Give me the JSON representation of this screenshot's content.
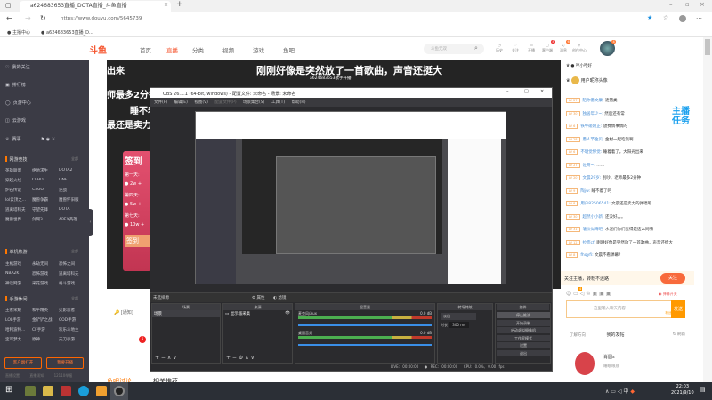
{
  "browser": {
    "tab_title": "a624683653直播_DOTA直播_斗鱼直播",
    "url": "https://www.douyu.com/5645739",
    "bookmarks": [
      "主播中心",
      "a624683653直播_D..."
    ]
  },
  "header": {
    "logo": "斗鱼",
    "nav": [
      "首页",
      "直播",
      "分类",
      "视频",
      "游戏",
      "鱼吧"
    ],
    "search_placeholder": "斗鱼无双",
    "icons": [
      {
        "label": "历史"
      },
      {
        "label": "关注"
      },
      {
        "label": "开播"
      },
      {
        "label": "客户端",
        "badge": "8"
      },
      {
        "label": "消息",
        "badge": "6"
      },
      {
        "label": "创作中心"
      }
    ],
    "avatar_badge": "4"
  },
  "sidebar": {
    "items": [
      "我的关注",
      "排行榜",
      "页游中心",
      "云游戏",
      "赛事"
    ],
    "sections": [
      {
        "title": "网游竞技",
        "more": "全部",
        "games": [
          "英雄联盟",
          "绝地求生",
          "DOTA2",
          "穿越火线",
          "CFHD",
          "DNF",
          "炉石传说",
          "CSGO",
          "逆战",
          "lol云顶之...",
          "魔兽争霸",
          "魔兽怀旧服",
          "逃离塔科夫",
          "守望先锋",
          "DOTA",
          "魔兽世界",
          "剑网3",
          "APEX英雄"
        ]
      },
      {
        "title": "单机热游",
        "more": "全部",
        "games": [
          "主机游戏",
          "永劫无间",
          "恐怖之间",
          "NBA2K",
          "恐怖游戏",
          "逃离塔科夫",
          "神话网游",
          "采花游戏",
          "格斗游戏"
        ]
      },
      {
        "title": "手游休闲",
        "more": "全部",
        "games": [
          "王者荣耀",
          "和平精英",
          "火影忍者",
          "LOL手游",
          "金铲铲之战",
          "COD手游",
          "哈利波特...",
          "CF手游",
          "欢乐斗地主",
          "宝可梦大...",
          "原神",
          "天刀手游"
        ]
      }
    ],
    "buttons": [
      "客户端打开",
      "我要开播"
    ],
    "footer": [
      "直播设置",
      "直播须知",
      "12110举报"
    ]
  },
  "stream": {
    "title": "刚刚好像是突然放了一首歌曲，声音还挺大",
    "subtitle": "a624683653歌手开播",
    "left_texts": [
      "出来",
      "师最多2分钟",
      "睡不着",
      "最还是卖力的"
    ],
    "signin": {
      "title": "签到",
      "days": [
        "第一天:",
        "第四天:",
        "第七天:"
      ],
      "rewards": [
        "2w +",
        "5w +",
        "10w +"
      ],
      "button": "签到"
    }
  },
  "obs": {
    "title": "OBS 26.1.1 (64-bit, windows) - 配置文件: 未命名 - 场景: 未命名",
    "menu": [
      "文件(F)",
      "编辑(E)",
      "视图(V)",
      "配置文件(P)",
      "场景集合(S)",
      "工具(T)",
      "帮助(H)"
    ],
    "source_bar": {
      "label": "未选择源",
      "props": "属性",
      "filters": "滤镜"
    },
    "docks": {
      "scenes": "场景",
      "sources": "来源",
      "mixer": "混音器",
      "transitions": "转场特效",
      "controls": "控件"
    },
    "scene_list": [
      "场景"
    ],
    "source_list": [
      "显示器采集"
    ],
    "mixer": [
      {
        "name": "麦克风/Aux",
        "db": "0.0 dB"
      },
      {
        "name": "桌面音频",
        "db": "0.0 dB"
      }
    ],
    "transition": {
      "type": "淡出",
      "duration_label": "时长",
      "duration": "300 ms"
    },
    "controls": [
      "停止推流",
      "开始录制",
      "启动虚拟摄像机",
      "工作室模式",
      "设置",
      "退出"
    ],
    "status": {
      "live": "LIVE: 00:00:00",
      "rec": "REC: 00:00:00",
      "cpu": "CPU: 0.0%, 0.00 fps"
    }
  },
  "chat": {
    "top_users": [
      "哼小哼好",
      "用户昵称头像"
    ],
    "messages": [
      {
        "lv": "LV 27",
        "name": "陌你番文康:",
        "text": "逐错类"
      },
      {
        "lv": "LV 30",
        "name": "独居年少~:",
        "text": "然后还有常"
      },
      {
        "lv": "LV 6",
        "name": "铁牛碰刚正:",
        "text": "放费情事情的"
      },
      {
        "lv": "LV 28",
        "name": "愚人节金贝:",
        "text": "金村一起吃饭啊"
      },
      {
        "lv": "LV 6",
        "name": "不明觉惨觉:",
        "text": "睡着着了。大阳光出来"
      },
      {
        "lv": "LV 27",
        "name": "佐哥~:",
        "text": "……"
      },
      {
        "lv": "LV 20",
        "name": "文晨29岁:",
        "text": "别吵。老师最多2分钟"
      },
      {
        "lv": "LV 9",
        "name": "陶jw:",
        "text": "睡不着了呵"
      },
      {
        "lv": "LV 8",
        "name": "用户82506541:",
        "text": "文晨还是卖力的弹唱吧"
      },
      {
        "lv": "LV 30",
        "name": "超然小小新:",
        "text": "还没好。。。"
      },
      {
        "lv": "LV 31",
        "name": "皱纹似海吧:",
        "text": "水泥们你们觉得是这么同嗨"
      },
      {
        "lv": "LV 12",
        "name": "拉而cf:",
        "text": "刚刚好像是突然放了一首歌曲，声音还挺大"
      },
      {
        "lv": "LV 8",
        "name": "fhqyfi:",
        "text": "文晨不看弹幕?"
      }
    ],
    "follow_text": "关注主播，转粉不迷路",
    "follow_button": "关注",
    "gift_badge": "4",
    "barrage_label": "弹幕开关",
    "input_placeholder": "这里输入聊天内容",
    "input_hint": "粉丝团弹幕",
    "send_button": "发送",
    "tabs": [
      "了解方向",
      "我的发帖",
      "刷新"
    ],
    "post_user": "肖圆s",
    "post_text": "睡眠眼底"
  },
  "below": {
    "discuss_tab": "鱼吧讨论",
    "related_tab": "相关推荐",
    "live_tag": "[通知]",
    "badge": "1"
  },
  "taskbar": {
    "time": "22:03",
    "date": "2021/9/10",
    "ime": "中"
  }
}
